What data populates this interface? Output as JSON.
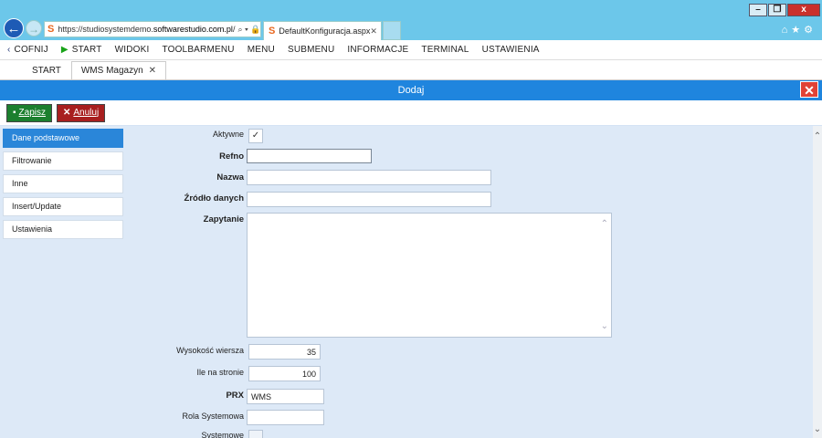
{
  "browser": {
    "url_prefix": "https://studiosystemdemo.",
    "url_domain": "softwarestudio.com.pl",
    "url_suffix": "/",
    "address_icons": "⌕ ▾ 🔒 ↻",
    "tab_title": "DefaultKonfiguracja.aspx",
    "window_min": "–",
    "window_max": "❐",
    "window_close": "x"
  },
  "app_menu": [
    {
      "label": "COFNIJ",
      "icon": "‹"
    },
    {
      "label": "START",
      "icon": "▶"
    },
    {
      "label": "WIDOKI"
    },
    {
      "label": "TOOLBARMENU"
    },
    {
      "label": "MENU"
    },
    {
      "label": "SUBMENU"
    },
    {
      "label": "INFORMACJE"
    },
    {
      "label": "TERMINAL"
    },
    {
      "label": "USTAWIENIA"
    }
  ],
  "app_tabs": [
    {
      "label": "START"
    },
    {
      "label": "WMS Magazyn",
      "close": "✕"
    }
  ],
  "dialog": {
    "title": "Dodaj"
  },
  "toolbar": {
    "save_label": "Zapisz",
    "cancel_label": "Anuluj"
  },
  "side_nav": [
    {
      "label": "Dane podstawowe"
    },
    {
      "label": "Filtrowanie"
    },
    {
      "label": "Inne"
    },
    {
      "label": "Insert/Update"
    },
    {
      "label": "Ustawienia"
    }
  ],
  "form": {
    "aktywne_label": "Aktywne",
    "aktywne_check": "✓",
    "refno_label": "Refno",
    "refno_value": "",
    "nazwa_label": "Nazwa",
    "nazwa_value": "",
    "zrodlo_label": "Źródło danych",
    "zrodlo_value": "",
    "zapytanie_label": "Zapytanie",
    "wysokosc_label": "Wysokość wiersza",
    "wysokosc_value": "35",
    "ile_label": "Ile na stronie",
    "ile_value": "100",
    "prx_label": "PRX",
    "prx_value": "WMS",
    "rola_label": "Rola Systemowa",
    "rola_value": "",
    "systemowe_label": "Systemowe"
  },
  "colors": {
    "browser_chrome": "#6cc7ea",
    "dialog_header": "#1f85de",
    "save_button": "#1c7f2e",
    "cancel_button": "#a81f1f",
    "active_nav": "#2a86d9",
    "content_bg": "#dde9f7"
  }
}
